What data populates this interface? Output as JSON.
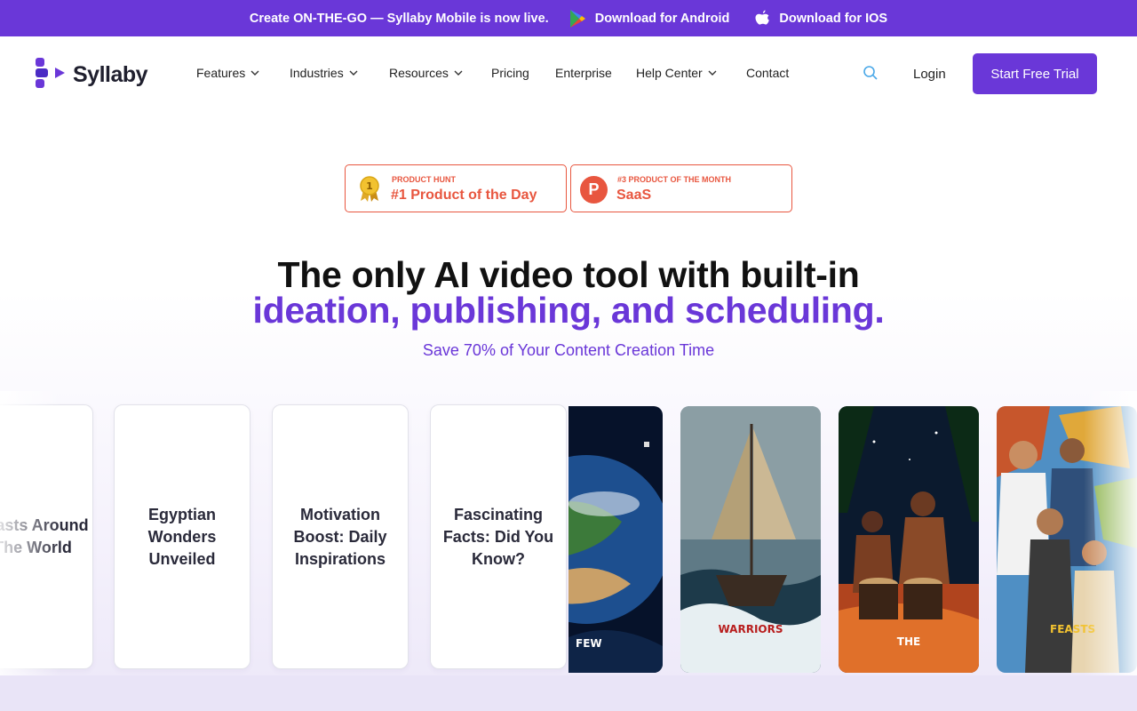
{
  "promo": {
    "message": "Create ON-THE-GO — Syllaby Mobile is now live.",
    "android_label": "Download for Android",
    "ios_label": "Download for IOS",
    "background": "#6a37d8"
  },
  "nav": {
    "brand": "Syllaby",
    "items": [
      {
        "label": "Features",
        "dropdown": true
      },
      {
        "label": "Industries",
        "dropdown": true
      },
      {
        "label": "Resources",
        "dropdown": true
      },
      {
        "label": "Pricing",
        "dropdown": false
      },
      {
        "label": "Enterprise",
        "dropdown": false
      },
      {
        "label": "Help Center",
        "dropdown": true
      },
      {
        "label": "Contact",
        "dropdown": false
      }
    ],
    "login": "Login",
    "cta": "Start Free Trial"
  },
  "badges": [
    {
      "kicker": "PRODUCT HUNT",
      "title": "#1 Product of the Day",
      "icon": "medal-icon",
      "rank": "1"
    },
    {
      "kicker": "#3 PRODUCT OF THE MONTH",
      "title": "SaaS",
      "icon": "product-hunt-icon",
      "letter": "P"
    }
  ],
  "hero": {
    "headline_line1": "The only AI video tool with built-in",
    "headline_line2": "ideation, publishing, and scheduling.",
    "subheadline": "Save 70% of Your Content Creation Time"
  },
  "idea_cards": [
    {
      "title": "Feasts Around The World"
    },
    {
      "title": "Egyptian Wonders Unveiled"
    },
    {
      "title": "Motivation Boost: Daily Inspirations"
    },
    {
      "title": "Fascinating Facts: Did You Know?"
    }
  ],
  "video_cards": [
    {
      "caption": "FEW",
      "scene": "earth-from-space"
    },
    {
      "caption": "WARRIORS",
      "scene": "sailing-ship"
    },
    {
      "caption": "THE",
      "scene": "drummers-night"
    },
    {
      "caption": "FEASTS",
      "scene": "people-world-map"
    }
  ],
  "colors": {
    "accent": "#6a37d8",
    "badge": "#e8563f"
  }
}
